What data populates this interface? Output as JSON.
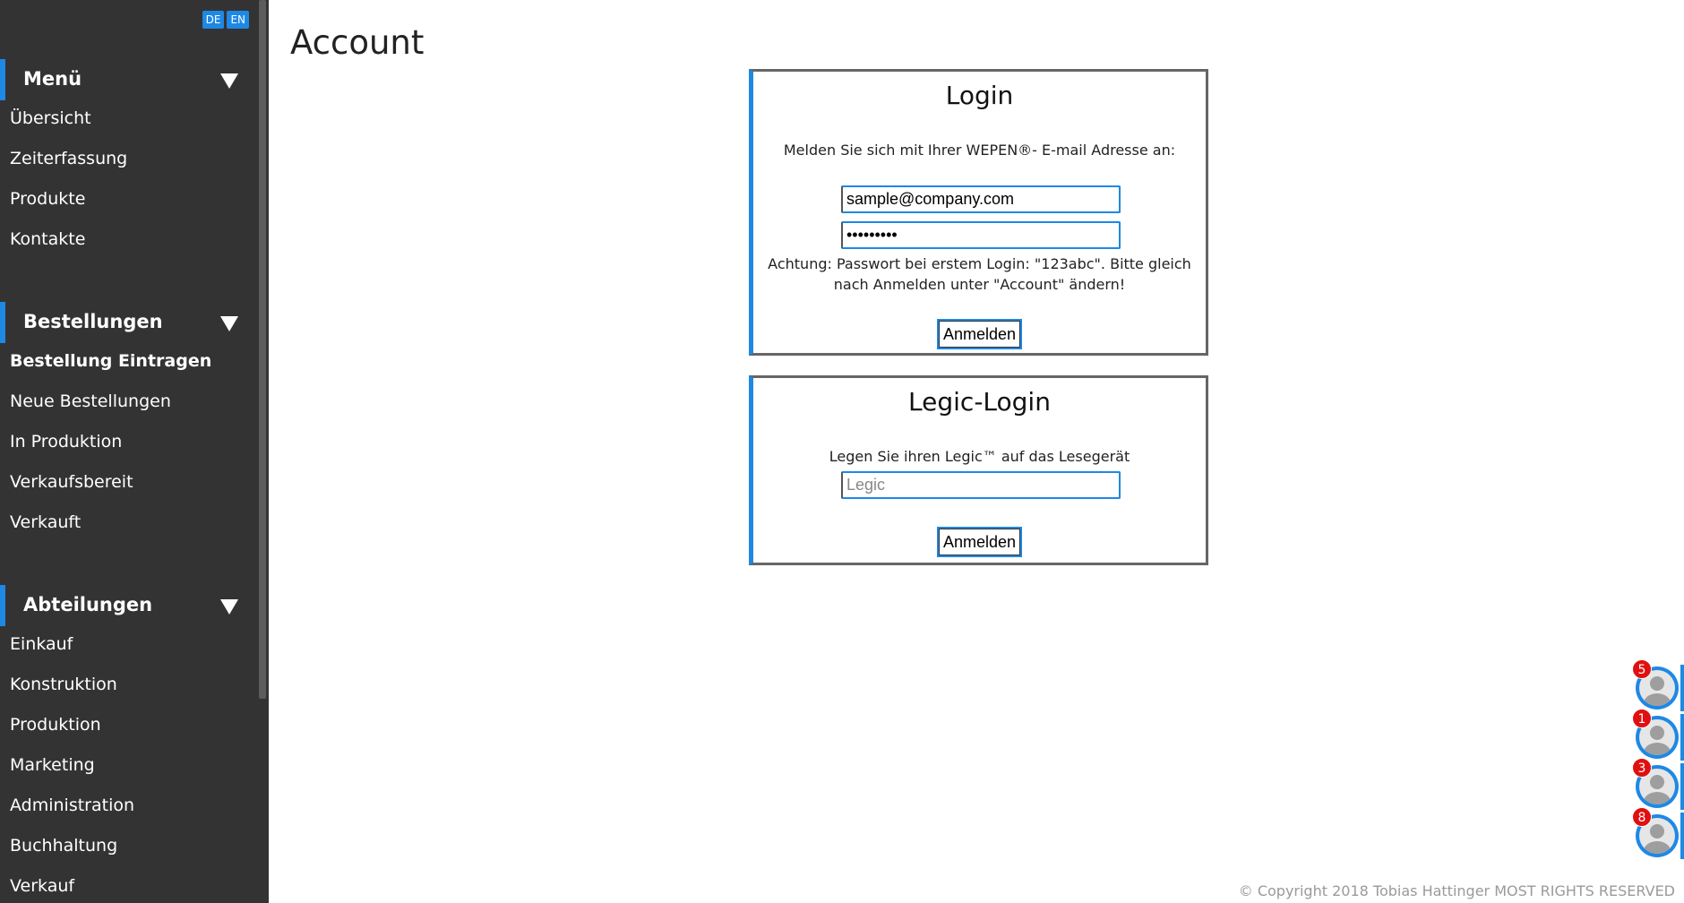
{
  "language": {
    "de": "DE",
    "en": "EN"
  },
  "sidebar": {
    "sections": [
      {
        "title": "Menü",
        "items": [
          "Übersicht",
          "Zeiterfassung",
          "Produkte",
          "Kontakte"
        ]
      },
      {
        "title": "Bestellungen",
        "items": [
          "Bestellung Eintragen",
          "Neue Bestellungen",
          "In Produktion",
          "Verkaufsbereit",
          "Verkauft"
        ],
        "active_item": "Bestellung Eintragen"
      },
      {
        "title": "Abteilungen",
        "items": [
          "Einkauf",
          "Konstruktion",
          "Produktion",
          "Marketing",
          "Administration",
          "Buchhaltung",
          "Verkauf"
        ]
      }
    ]
  },
  "page": {
    "title": "Account"
  },
  "login": {
    "title": "Login",
    "instruction": "Melden Sie sich mit Ihrer WEPEN®- E-mail Adresse an:",
    "email_value": "sample@company.com",
    "password_value": "•••••••••",
    "warning": "Achtung: Passwort bei erstem Login: \"123abc\". Bitte gleich nach Anmelden unter \"Account\" ändern!",
    "button": "Anmelden"
  },
  "legic_login": {
    "title": "Legic-Login",
    "instruction": "Legen Sie ihren Legic™ auf das Lesegerät",
    "placeholder": "Legic",
    "button": "Anmelden"
  },
  "contacts": [
    {
      "badge": "5"
    },
    {
      "badge": "1"
    },
    {
      "badge": "3"
    },
    {
      "badge": "8"
    }
  ],
  "footer": {
    "copyright": "© Copyright 2018 Tobias Hattinger MOST RIGHTS RESERVED"
  },
  "colors": {
    "accent": "#1e88e5",
    "sidebar_bg": "#333333",
    "badge": "#e01010"
  }
}
